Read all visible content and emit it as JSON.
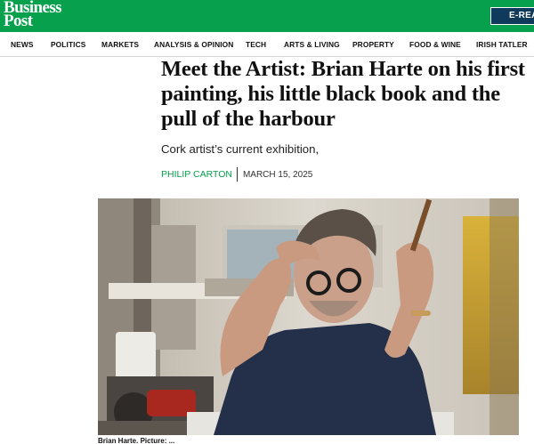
{
  "header": {
    "logo_line1": "Business",
    "logo_line2": "Post",
    "ereader_label": "E-REA"
  },
  "nav": {
    "items": [
      "NEWS",
      "POLITICS",
      "MARKETS",
      "ANALYSIS & OPINION",
      "TECH",
      "ARTS & LIVING",
      "PROPERTY",
      "FOOD & WINE",
      "IRISH TATLER"
    ]
  },
  "article": {
    "headline": "Meet the Artist: Brian Harte on his first painting, his little black book and the pull of the harbour",
    "subheading": "Cork artist’s current exhibition,",
    "author": "PHILIP CARTON",
    "date": "MARCH 15, 2025",
    "caption": "Brian Harte. Picture: ..."
  },
  "colors": {
    "brand_green": "#07a04d",
    "ereader_navy": "#0f3a5c"
  }
}
